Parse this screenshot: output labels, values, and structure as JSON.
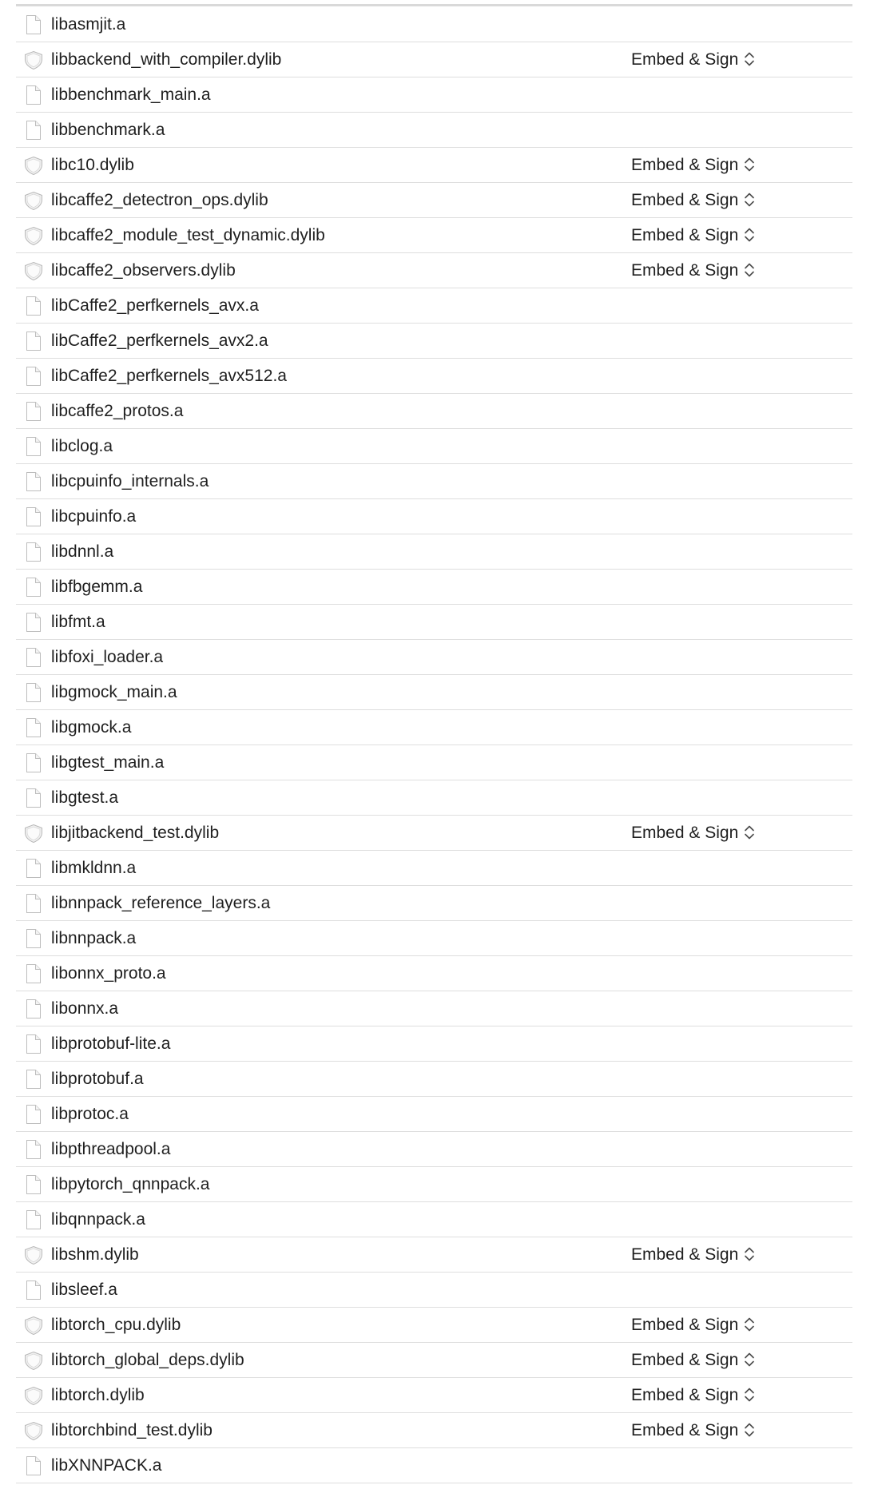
{
  "embed_label": "Embed & Sign",
  "icons": {
    "static": "document-icon",
    "dynamic": "library-shield-icon",
    "stepper": "chevron-up-down-icon"
  },
  "frameworks": [
    {
      "name": "libasmjit.a",
      "kind": "static"
    },
    {
      "name": "libbackend_with_compiler.dylib",
      "kind": "dynamic",
      "embed": "Embed & Sign"
    },
    {
      "name": "libbenchmark_main.a",
      "kind": "static"
    },
    {
      "name": "libbenchmark.a",
      "kind": "static"
    },
    {
      "name": "libc10.dylib",
      "kind": "dynamic",
      "embed": "Embed & Sign"
    },
    {
      "name": "libcaffe2_detectron_ops.dylib",
      "kind": "dynamic",
      "embed": "Embed & Sign"
    },
    {
      "name": "libcaffe2_module_test_dynamic.dylib",
      "kind": "dynamic",
      "embed": "Embed & Sign"
    },
    {
      "name": "libcaffe2_observers.dylib",
      "kind": "dynamic",
      "embed": "Embed & Sign"
    },
    {
      "name": "libCaffe2_perfkernels_avx.a",
      "kind": "static"
    },
    {
      "name": "libCaffe2_perfkernels_avx2.a",
      "kind": "static"
    },
    {
      "name": "libCaffe2_perfkernels_avx512.a",
      "kind": "static"
    },
    {
      "name": "libcaffe2_protos.a",
      "kind": "static"
    },
    {
      "name": "libclog.a",
      "kind": "static"
    },
    {
      "name": "libcpuinfo_internals.a",
      "kind": "static"
    },
    {
      "name": "libcpuinfo.a",
      "kind": "static"
    },
    {
      "name": "libdnnl.a",
      "kind": "static"
    },
    {
      "name": "libfbgemm.a",
      "kind": "static"
    },
    {
      "name": "libfmt.a",
      "kind": "static"
    },
    {
      "name": "libfoxi_loader.a",
      "kind": "static"
    },
    {
      "name": "libgmock_main.a",
      "kind": "static"
    },
    {
      "name": "libgmock.a",
      "kind": "static"
    },
    {
      "name": "libgtest_main.a",
      "kind": "static"
    },
    {
      "name": "libgtest.a",
      "kind": "static"
    },
    {
      "name": "libjitbackend_test.dylib",
      "kind": "dynamic",
      "embed": "Embed & Sign"
    },
    {
      "name": "libmkldnn.a",
      "kind": "static"
    },
    {
      "name": "libnnpack_reference_layers.a",
      "kind": "static"
    },
    {
      "name": "libnnpack.a",
      "kind": "static"
    },
    {
      "name": "libonnx_proto.a",
      "kind": "static"
    },
    {
      "name": "libonnx.a",
      "kind": "static"
    },
    {
      "name": "libprotobuf-lite.a",
      "kind": "static"
    },
    {
      "name": "libprotobuf.a",
      "kind": "static"
    },
    {
      "name": "libprotoc.a",
      "kind": "static"
    },
    {
      "name": "libpthreadpool.a",
      "kind": "static"
    },
    {
      "name": "libpytorch_qnnpack.a",
      "kind": "static"
    },
    {
      "name": "libqnnpack.a",
      "kind": "static"
    },
    {
      "name": "libshm.dylib",
      "kind": "dynamic",
      "embed": "Embed & Sign"
    },
    {
      "name": "libsleef.a",
      "kind": "static"
    },
    {
      "name": "libtorch_cpu.dylib",
      "kind": "dynamic",
      "embed": "Embed & Sign"
    },
    {
      "name": "libtorch_global_deps.dylib",
      "kind": "dynamic",
      "embed": "Embed & Sign"
    },
    {
      "name": "libtorch.dylib",
      "kind": "dynamic",
      "embed": "Embed & Sign"
    },
    {
      "name": "libtorchbind_test.dylib",
      "kind": "dynamic",
      "embed": "Embed & Sign"
    },
    {
      "name": "libXNNPACK.a",
      "kind": "static"
    }
  ]
}
